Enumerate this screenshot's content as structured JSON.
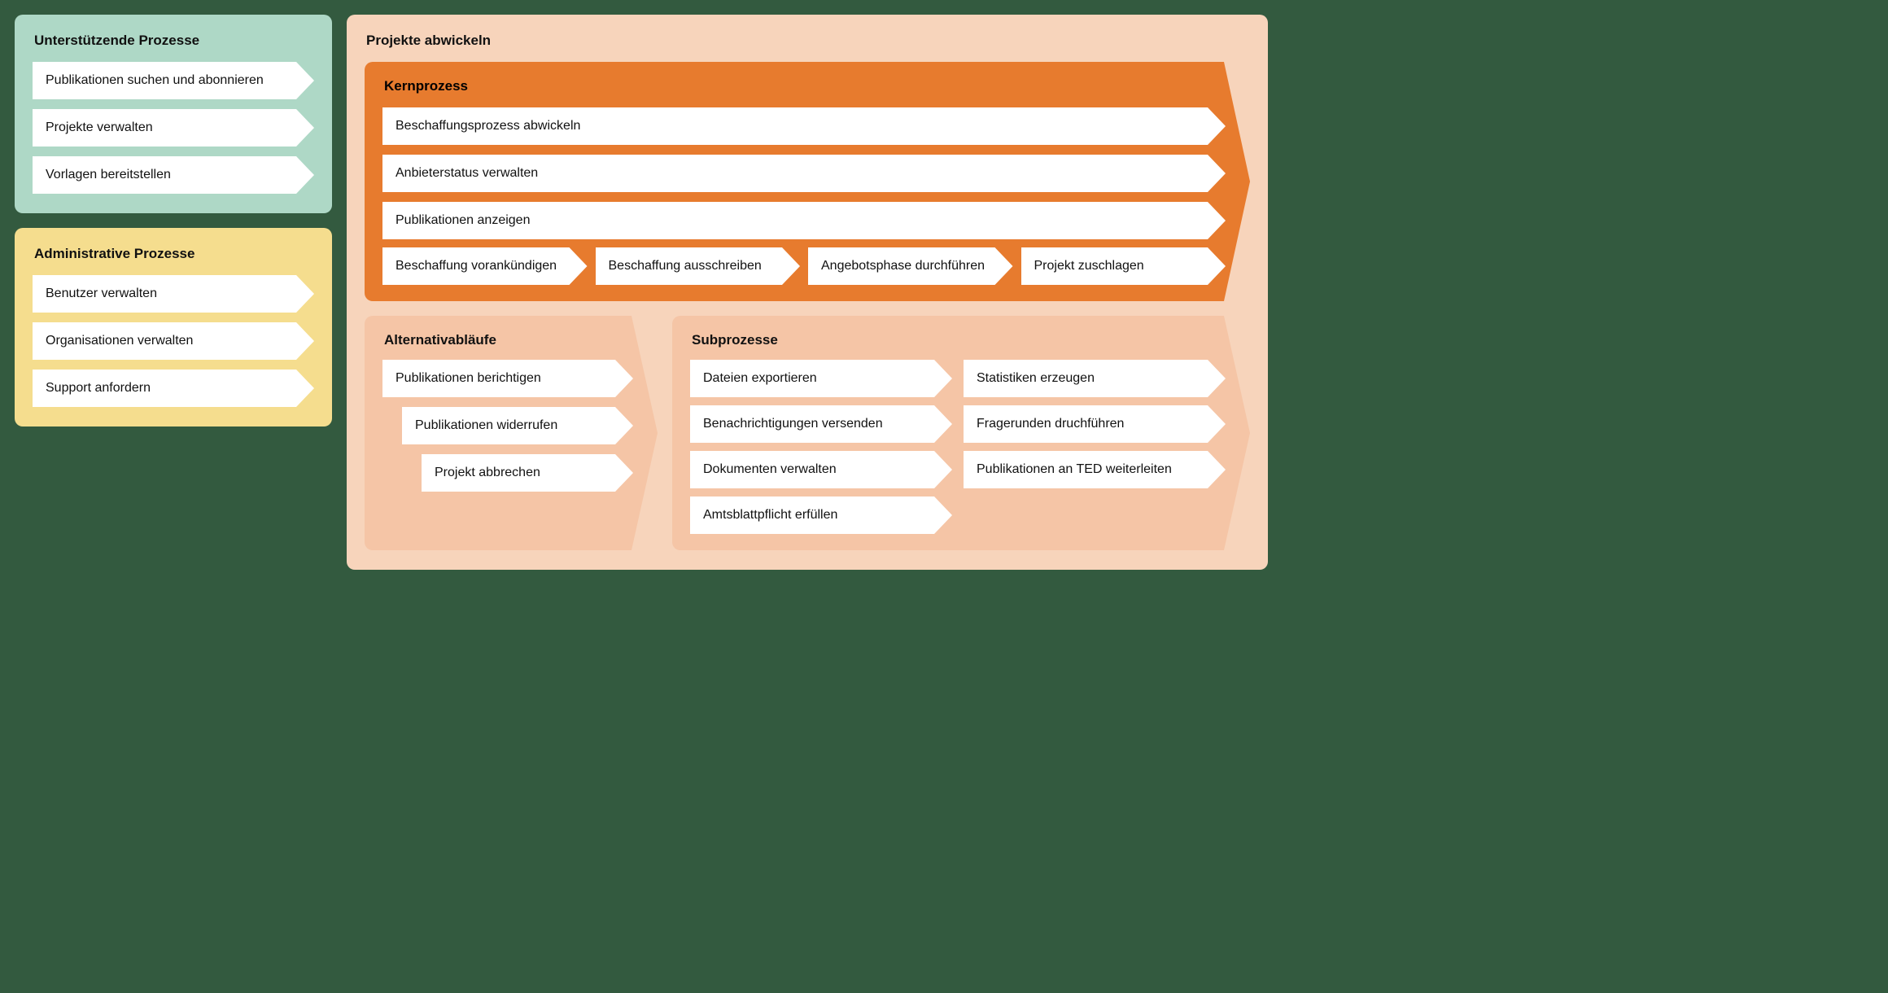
{
  "left": {
    "support": {
      "title": "Unterstützende Prozesse",
      "items": [
        "Publikationen suchen und abonnieren",
        "Projekte verwalten",
        "Vorlagen bereitstellen"
      ]
    },
    "admin": {
      "title": "Administrative Prozesse",
      "items": [
        "Benutzer verwalten",
        "Organisationen verwalten",
        "Support anfordern"
      ]
    }
  },
  "right": {
    "title": "Projekte abwickeln",
    "core": {
      "title": "Kernprozess",
      "rows": [
        "Beschaffungsprozess abwickeln",
        "Anbieterstatus verwalten",
        "Publikationen anzeigen"
      ],
      "phases": [
        "Beschaffung vorankündigen",
        "Beschaffung ausschreiben",
        "Angebotsphase durchführen",
        "Projekt zuschlagen"
      ]
    },
    "alt": {
      "title": "Alternativabläufe",
      "items": [
        "Publikationen berichtigen",
        "Publikationen widerrufen",
        "Projekt abbrechen"
      ]
    },
    "sub": {
      "title": "Subprozesse",
      "col1": [
        "Dateien exportieren",
        "Benachrichtigungen versenden",
        "Dokumenten verwalten",
        "Amtsblattpflicht erfüllen"
      ],
      "col2": [
        "Statistiken erzeugen",
        "Fragerunden druchführen",
        "Publikationen an TED weiterleiten"
      ]
    }
  }
}
